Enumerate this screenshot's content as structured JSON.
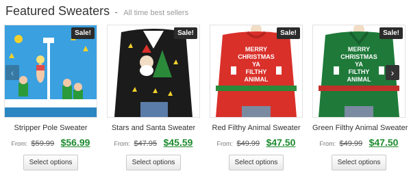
{
  "header": {
    "title": "Featured Sweaters",
    "separator": "-",
    "subtitle": "All time best sellers"
  },
  "carousel": {
    "prev_icon": "‹",
    "next_icon": "›"
  },
  "products": [
    {
      "name": "Stripper Pole Sweater",
      "badge": "Sale!",
      "from_label": "From:",
      "old_price": "$59.99",
      "new_price": "$56.99",
      "button_label": "Select options",
      "sweater_color": "#3aa0e0"
    },
    {
      "name": "Stars and Santa Sweater",
      "badge": "Sale!",
      "from_label": "From:",
      "old_price": "$47.95",
      "new_price": "$45.59",
      "button_label": "Select options",
      "sweater_color": "#1b1b1b"
    },
    {
      "name": "Red Filthy Animal Sweater",
      "badge": "Sale!",
      "from_label": "From:",
      "old_price": "$49.99",
      "new_price": "$47.50",
      "button_label": "Select options",
      "sweater_color": "#d9302a",
      "sweater_text": "MERRY CHRISTMAS YA FILTHY ANIMAL"
    },
    {
      "name": "Green Filthy Animal Sweater",
      "badge": "Sale!",
      "from_label": "From:",
      "old_price": "$49.99",
      "new_price": "$47.50",
      "button_label": "Select options",
      "sweater_color": "#1f7a3a",
      "sweater_text": "MERRY CHRISTMAS YA FILTHY ANIMAL"
    }
  ]
}
